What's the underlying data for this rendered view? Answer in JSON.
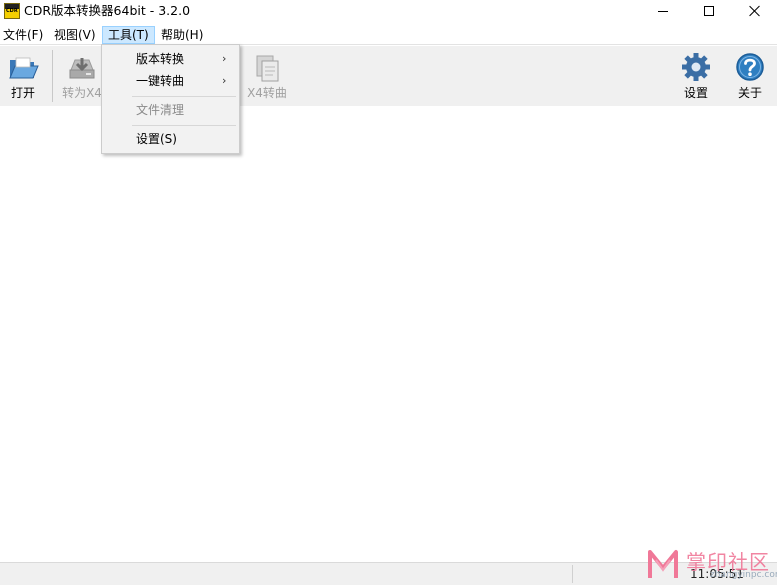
{
  "window": {
    "title": "CDR版本转换器64bit - 3.2.0",
    "app_icon_text": "CDR"
  },
  "menubar": {
    "items": [
      {
        "label": "文件(F)"
      },
      {
        "label": "视图(V)"
      },
      {
        "label": "工具(T)",
        "active": true
      },
      {
        "label": "帮助(H)"
      }
    ]
  },
  "toolbar": {
    "open_label": "打开",
    "convert_x4_label": "转为X4",
    "x4_curve_label": "X4转曲",
    "settings_label": "设置",
    "about_label": "关于"
  },
  "tools_menu": {
    "items": [
      {
        "label": "版本转换",
        "submenu": true
      },
      {
        "label": "一键转曲",
        "submenu": true
      },
      {
        "label": "文件清理",
        "disabled": true
      },
      {
        "label": "设置(S)"
      }
    ]
  },
  "statusbar": {
    "time": "11:05:51"
  },
  "watermark": {
    "text": "掌印社区",
    "url": "zhangyinpc.com"
  },
  "colors": {
    "toolbar_bg": "#f0f0f0",
    "menu_active_bg": "#cce8ff",
    "accent_blue": "#2f7fc1",
    "watermark_pink": "#f07898"
  }
}
